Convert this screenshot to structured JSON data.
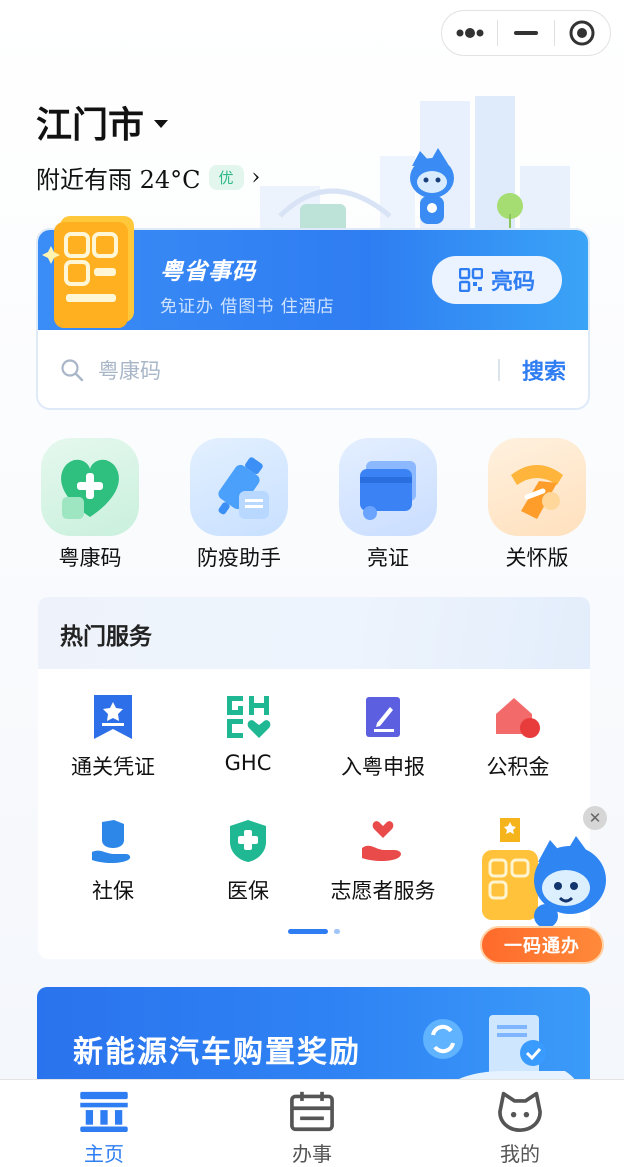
{
  "header": {
    "city": "江门市",
    "weather": "附近有雨 24°C",
    "air_quality": "优"
  },
  "capsule": {
    "more_icon": "more-dots-icon",
    "minimize_icon": "minimize-icon",
    "close_icon": "target-close-icon"
  },
  "code_card": {
    "title": "粤省事码",
    "subtitle": "免证办 借图书 住酒店",
    "show_button": "亮码",
    "search_placeholder": "粤康码",
    "search_button": "搜索"
  },
  "quick_actions": [
    {
      "label": "粤康码",
      "icon": "health-heart-icon",
      "color": "#35c48a"
    },
    {
      "label": "防疫助手",
      "icon": "syringe-icon",
      "color": "#3b8ff5"
    },
    {
      "label": "亮证",
      "icon": "card-icon",
      "color": "#3b83f5"
    },
    {
      "label": "关怀版",
      "icon": "scarf-icon",
      "color": "#ffa533"
    }
  ],
  "hot_services": {
    "title": "热门服务",
    "items": [
      {
        "label": "通关凭证",
        "icon": "ticket-star-icon",
        "color": "#2d6fe8"
      },
      {
        "label": "GHC",
        "icon": "ghc-logo-icon",
        "color": "#1fb893"
      },
      {
        "label": "入粤申报",
        "icon": "edit-doc-icon",
        "color": "#5b5fe0"
      },
      {
        "label": "公积金",
        "icon": "house-coin-icon",
        "color": "#e94b4b"
      },
      {
        "label": "社保",
        "icon": "hand-person-icon",
        "color": "#2d87e8"
      },
      {
        "label": "医保",
        "icon": "shield-cross-icon",
        "color": "#1fb893"
      },
      {
        "label": "志愿者服务",
        "icon": "hand-heart-icon",
        "color": "#e94b4b"
      }
    ],
    "page_indicator": {
      "current": 1,
      "total": 2
    }
  },
  "floating_badge": {
    "label": "一码通办"
  },
  "banner": {
    "title": "新能源汽车购置奖励"
  },
  "tabbar": [
    {
      "label": "主页",
      "icon": "home-building-icon",
      "active": true
    },
    {
      "label": "办事",
      "icon": "calendar-icon",
      "active": false
    },
    {
      "label": "我的",
      "icon": "mascot-face-icon",
      "active": false
    }
  ],
  "colors": {
    "accent": "#2f7df2",
    "tab_active": "#2f7df2",
    "tab_inactive": "#555555"
  }
}
